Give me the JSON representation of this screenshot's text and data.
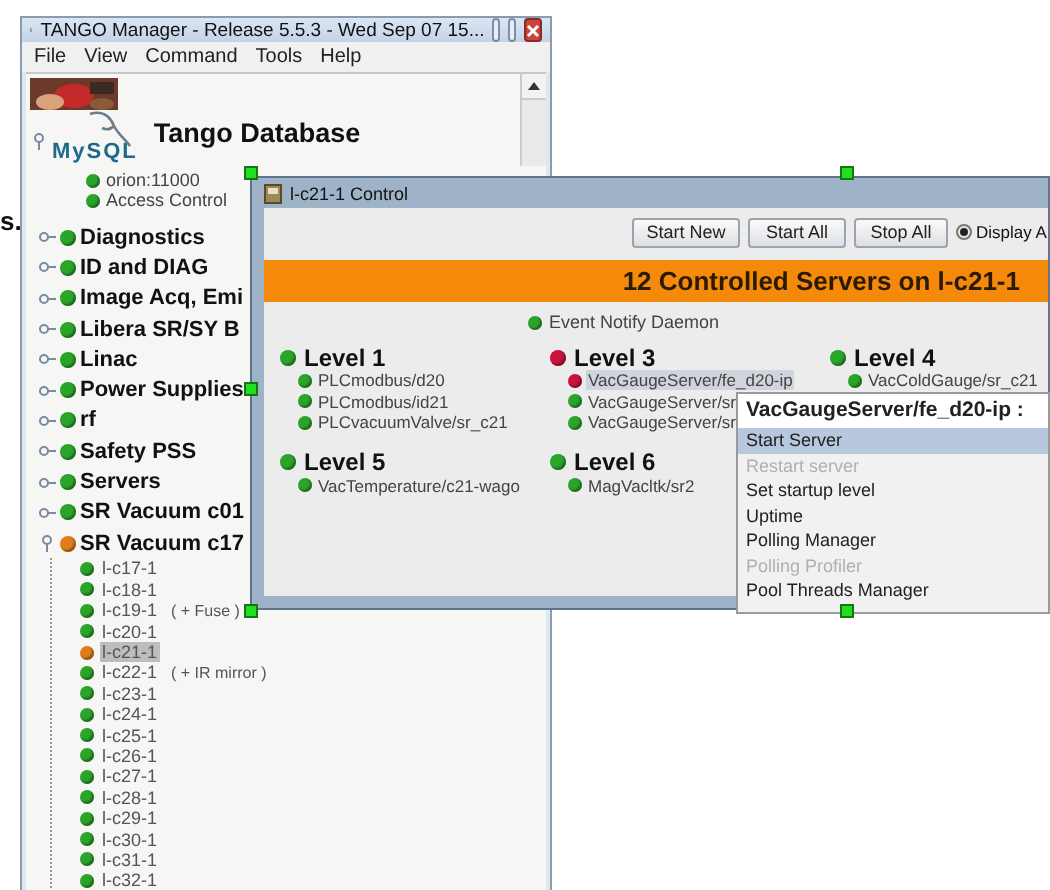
{
  "desktop": {
    "fragment_text": "s."
  },
  "main_window": {
    "title": "TANGO Manager - Release 5.5.3  -  Wed Sep 07 15...",
    "menu": [
      "File",
      "View",
      "Command",
      "Tools",
      "Help"
    ],
    "tree": {
      "root": {
        "logo": "MySQL",
        "label": "Tango Database",
        "expanded": true,
        "children": [
          {
            "label": "orion:11000",
            "color": "#2aa52a"
          },
          {
            "label": "Access Control",
            "color": "#2aa52a"
          }
        ]
      },
      "items": [
        {
          "label": "Diagnostics",
          "color": "#2aa52a",
          "expanded": false
        },
        {
          "label": "ID and DIAG",
          "color": "#2aa52a",
          "expanded": false
        },
        {
          "label": "Image Acq, Emi",
          "color": "#2aa52a",
          "expanded": false
        },
        {
          "label": "Libera SR/SY B",
          "color": "#2aa52a",
          "expanded": false
        },
        {
          "label": "Linac",
          "color": "#2aa52a",
          "expanded": false
        },
        {
          "label": "Power Supplies",
          "color": "#2aa52a",
          "expanded": false
        },
        {
          "label": "rf",
          "color": "#2aa52a",
          "expanded": false
        },
        {
          "label": "Safety PSS",
          "color": "#2aa52a",
          "expanded": false
        },
        {
          "label": "Servers",
          "color": "#2aa52a",
          "expanded": false
        },
        {
          "label": "SR Vacuum c01",
          "color": "#2aa52a",
          "expanded": false
        },
        {
          "label": "SR Vacuum c17",
          "color": "#e07d1a",
          "expanded": true,
          "children": [
            {
              "label": "l-c17-1",
              "color": "#2aa52a",
              "selected": false
            },
            {
              "label": "l-c18-1",
              "color": "#2aa52a",
              "selected": false
            },
            {
              "label": "l-c19-1",
              "note": "( + Fuse )",
              "color": "#2aa52a",
              "selected": false
            },
            {
              "label": "l-c20-1",
              "color": "#2aa52a",
              "selected": false
            },
            {
              "label": "l-c21-1",
              "color": "#e07d1a",
              "selected": true
            },
            {
              "label": "l-c22-1",
              "note": "( + IR mirror )",
              "color": "#2aa52a",
              "selected": false
            },
            {
              "label": "l-c23-1",
              "color": "#2aa52a",
              "selected": false
            },
            {
              "label": "l-c24-1",
              "color": "#2aa52a",
              "selected": false
            },
            {
              "label": "l-c25-1",
              "color": "#2aa52a",
              "selected": false
            },
            {
              "label": "l-c26-1",
              "color": "#2aa52a",
              "selected": false
            },
            {
              "label": "l-c27-1",
              "color": "#2aa52a",
              "selected": false
            },
            {
              "label": "l-c28-1",
              "color": "#2aa52a",
              "selected": false
            },
            {
              "label": "l-c29-1",
              "color": "#2aa52a",
              "selected": false
            },
            {
              "label": "l-c30-1",
              "color": "#2aa52a",
              "selected": false
            },
            {
              "label": "l-c31-1",
              "color": "#2aa52a",
              "selected": false
            },
            {
              "label": "l-c32-1",
              "color": "#2aa52a",
              "selected": false
            }
          ]
        }
      ]
    }
  },
  "control_window": {
    "title": "l-c21-1  Control",
    "buttons": [
      "Start New",
      "Start All",
      "Stop All"
    ],
    "radio": {
      "label": "Display A",
      "selected": true
    },
    "banner": "12 Controlled Servers on l-c21-1",
    "daemon": {
      "label": "Event Notify Daemon",
      "color": "#2aa52a"
    },
    "levels": [
      {
        "label": "Level 1",
        "color": "#2aa52a",
        "servers": [
          {
            "label": "PLCmodbus/d20",
            "color": "#2aa52a",
            "selected": false
          },
          {
            "label": "PLCmodbus/id21",
            "color": "#2aa52a",
            "selected": false
          },
          {
            "label": "PLCvacuumValve/sr_c21",
            "color": "#2aa52a",
            "selected": false
          }
        ]
      },
      {
        "label": "Level 3",
        "color": "#c8143c",
        "servers": [
          {
            "label": "VacGaugeServer/fe_d20-ip",
            "color": "#c8143c",
            "selected": true
          },
          {
            "label": "VacGaugeServer/sr",
            "color": "#2aa52a",
            "selected": false
          },
          {
            "label": "VacGaugeServer/sr",
            "color": "#2aa52a",
            "selected": false
          }
        ]
      },
      {
        "label": "Level 4",
        "color": "#2aa52a",
        "servers": [
          {
            "label": "VacColdGauge/sr_c21",
            "color": "#2aa52a",
            "selected": false
          }
        ]
      },
      {
        "label": "Level 5",
        "color": "#2aa52a",
        "servers": [
          {
            "label": "VacTemperature/c21-wago",
            "color": "#2aa52a",
            "selected": false
          }
        ]
      },
      {
        "label": "Level 6",
        "color": "#2aa52a",
        "servers": [
          {
            "label": "MagVacltk/sr2",
            "color": "#2aa52a",
            "selected": false
          }
        ]
      }
    ]
  },
  "context_menu": {
    "title": "VacGaugeServer/fe_d20-ip  :",
    "items": [
      {
        "label": "Start Server",
        "selected": true,
        "disabled": false
      },
      {
        "label": "Restart server",
        "selected": false,
        "disabled": true
      },
      {
        "label": "Set startup level",
        "selected": false,
        "disabled": false
      },
      {
        "label": "Uptime",
        "selected": false,
        "disabled": false
      },
      {
        "label": "Polling Manager",
        "selected": false,
        "disabled": false
      },
      {
        "label": "Polling Profiler",
        "selected": false,
        "disabled": true
      },
      {
        "label": "Pool Threads Manager",
        "selected": false,
        "disabled": false
      }
    ]
  }
}
